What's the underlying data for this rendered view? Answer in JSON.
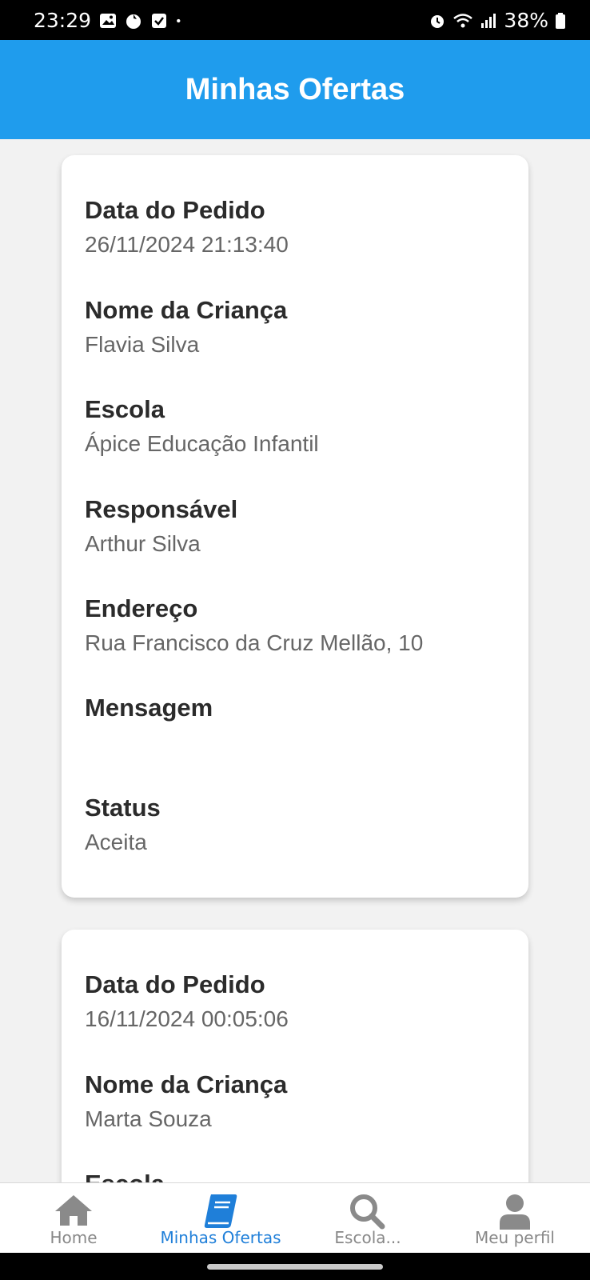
{
  "status_bar": {
    "time": "23:29",
    "battery": "38%",
    "left_icons": [
      "image-icon",
      "app-icon",
      "check-icon",
      "dot-icon"
    ],
    "right_icons": [
      "alarm-icon",
      "wifi-icon",
      "signal-icon",
      "battery-icon"
    ]
  },
  "header": {
    "title": "Minhas Ofertas"
  },
  "cards": [
    {
      "fields": [
        {
          "label": "Data do Pedido",
          "value": "26/11/2024 21:13:40"
        },
        {
          "label": "Nome da Criança",
          "value": "Flavia Silva"
        },
        {
          "label": "Escola",
          "value": "Ápice Educação Infantil"
        },
        {
          "label": "Responsável",
          "value": "Arthur Silva"
        },
        {
          "label": "Endereço",
          "value": "Rua Francisco da Cruz Mellão, 10"
        },
        {
          "label": "Mensagem",
          "value": ""
        },
        {
          "label": "Status",
          "value": "Aceita"
        }
      ]
    },
    {
      "fields": [
        {
          "label": "Data do Pedido",
          "value": "16/11/2024 00:05:06"
        },
        {
          "label": "Nome da Criança",
          "value": "Marta Souza"
        },
        {
          "label": "Escola",
          "value": ""
        }
      ]
    }
  ],
  "tabs": [
    {
      "label": "Home",
      "icon": "home-icon",
      "active": false
    },
    {
      "label": "Minhas Ofertas",
      "icon": "book-icon",
      "active": true
    },
    {
      "label": "Escola...",
      "icon": "search-icon",
      "active": false
    },
    {
      "label": "Meu perfil",
      "icon": "user-icon",
      "active": false
    }
  ],
  "colors": {
    "header": "#1f9ced",
    "active_tab": "#1f7fd9",
    "inactive_tab": "#888888"
  }
}
